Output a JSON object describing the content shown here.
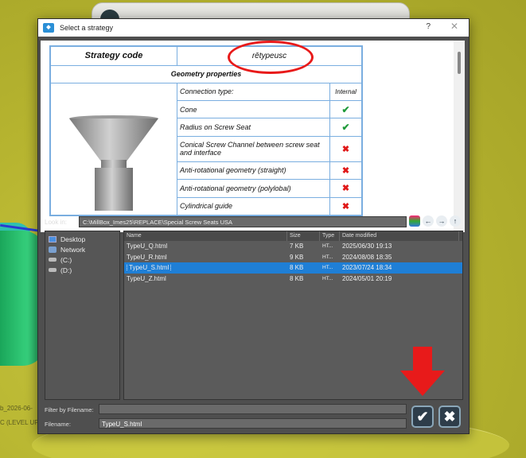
{
  "background": {
    "texts": [
      "b_2026-06-",
      "C (LEVEL UP"
    ]
  },
  "dialog": {
    "title": "Select a strategy",
    "help_glyph": "?",
    "close_glyph": "✕"
  },
  "preview": {
    "strategy_code_label": "Strategy code",
    "strategy_code_value": "rētypeusc",
    "geometry_header": "Geometry properties",
    "properties": [
      {
        "label": "Connection type:",
        "value": "Internal",
        "kind": "text"
      },
      {
        "label": "Cone",
        "value": "✔",
        "kind": "check"
      },
      {
        "label": "Radius on Screw Seat",
        "value": "✔",
        "kind": "check"
      },
      {
        "label": "Conical Screw Channel between screw seat and interface",
        "value": "✖",
        "kind": "cross"
      },
      {
        "label": "Anti-rotational geometry (straight)",
        "value": "✖",
        "kind": "cross"
      },
      {
        "label": "Anti-rotational geometry (polylobal)",
        "value": "✖",
        "kind": "cross"
      },
      {
        "label": "Cylindrical guide",
        "value": "✖",
        "kind": "cross"
      }
    ]
  },
  "lookin": {
    "label": "Look in:",
    "path": "C:\\MillBox_Imes25\\REPLACE\\Special Screw Seats USA"
  },
  "places": [
    {
      "label": "Desktop",
      "icon": "desktop-icon"
    },
    {
      "label": "Network",
      "icon": "network-icon"
    },
    {
      "label": "(C:)",
      "icon": "drive-icon"
    },
    {
      "label": "(D:)",
      "icon": "drive-icon"
    }
  ],
  "filelist": {
    "columns": [
      "Name",
      "Size",
      "Type",
      "Date modified"
    ],
    "rows": [
      {
        "name": "TypeU_Q.html",
        "size": "7 KB",
        "type": "HT...",
        "date": "2025/06/30 19:13"
      },
      {
        "name": "TypeU_R.html",
        "size": "9 KB",
        "type": "HT...",
        "date": "2024/08/08 18:35"
      },
      {
        "name": "TypeU_S.html",
        "size": "8 KB",
        "type": "HT...",
        "date": "2023/07/24 18:34"
      },
      {
        "name": "TypeU_Z.html",
        "size": "8 KB",
        "type": "HT...",
        "date": "2024/05/01 20:19"
      }
    ]
  },
  "filter": {
    "label": "Filter by Filename:",
    "value": ""
  },
  "filename": {
    "label": "Filename:",
    "value": "TypeU_S.html"
  },
  "buttons": {
    "ok": "✔",
    "cancel": "✖"
  },
  "colors": {
    "selection": "#1f7fd6",
    "annotation": "#e81a1a",
    "check": "#1f9a3a",
    "cross": "#e01818"
  }
}
